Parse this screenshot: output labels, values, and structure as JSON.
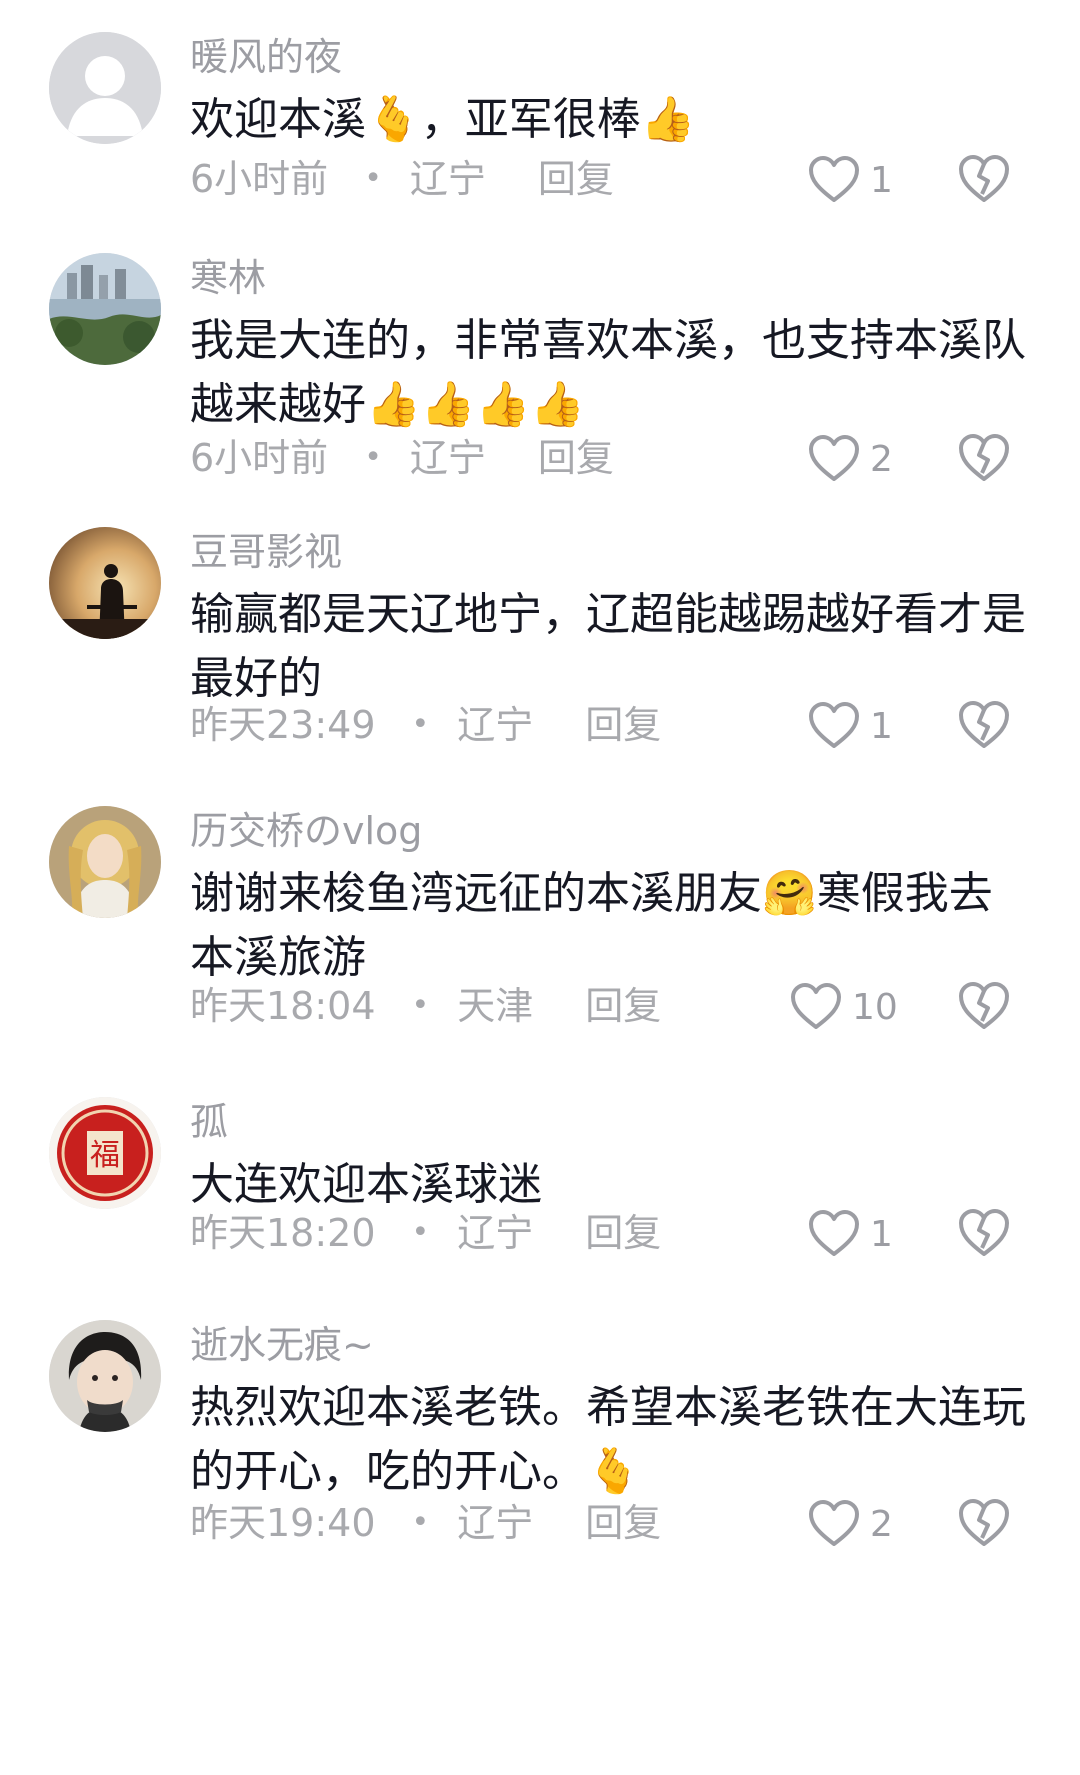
{
  "comments": [
    {
      "username": "暖风的夜",
      "text": "欢迎本溪🫰，亚军很棒👍",
      "time": "6小时前",
      "location": "辽宁",
      "reply_label": "回复",
      "likes": "1",
      "avatar": "default-user-avatar"
    },
    {
      "username": "寒林",
      "text": "我是大连的，非常喜欢本溪，也支持本溪队越来越好👍👍👍👍",
      "time": "6小时前",
      "location": "辽宁",
      "reply_label": "回复",
      "likes": "2",
      "avatar": "city-lake-photo-avatar"
    },
    {
      "username": "豆哥影视",
      "text": "输赢都是天辽地宁，辽超能越踢越好看才是最好的",
      "time": "昨天23:49",
      "location": "辽宁",
      "reply_label": "回复",
      "likes": "1",
      "avatar": "sunset-silhouette-avatar"
    },
    {
      "username": "历交桥のvlog",
      "text": "谢谢来梭鱼湾远征的本溪朋友🤗寒假我去本溪旅游",
      "time": "昨天18:04",
      "location": "天津",
      "reply_label": "回复",
      "likes": "10",
      "avatar": "doll-portrait-avatar"
    },
    {
      "username": "孤",
      "text": "大连欢迎本溪球迷",
      "time": "昨天18:20",
      "location": "辽宁",
      "reply_label": "回复",
      "likes": "1",
      "avatar": "fu-seal-avatar"
    },
    {
      "username": "逝水无痕~",
      "text": "热烈欢迎本溪老铁。希望本溪老铁在大连玩的开心，吃的开心。🫰",
      "time": "昨天19:40",
      "location": "辽宁",
      "reply_label": "回复",
      "likes": "2",
      "avatar": "child-portrait-avatar"
    }
  ],
  "icons": {
    "like": "heart-outline-icon",
    "dislike": "broken-heart-icon"
  },
  "colors": {
    "text": "#161823",
    "secondary": "#9c9da3",
    "background": "#ffffff"
  }
}
